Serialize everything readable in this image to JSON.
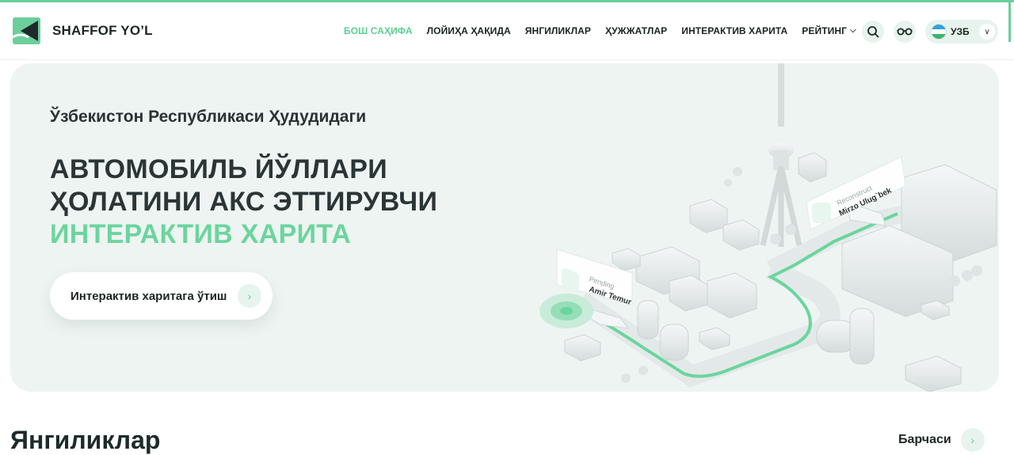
{
  "brand": {
    "name": "SHAFFOF YO’L",
    "accent": "#6ccf9b"
  },
  "nav": {
    "items": [
      {
        "label": "БОШ САҲИФА",
        "active": true
      },
      {
        "label": "ЛОЙИҲА ҲАҚИДА"
      },
      {
        "label": "ЯНГИЛИКЛАР"
      },
      {
        "label": "ҲУЖЖАТЛАР"
      },
      {
        "label": "ИНТЕРАКТИВ ХАРИТА"
      },
      {
        "label": "РЕЙТИНГ",
        "dropdown": true
      }
    ]
  },
  "toolbar": {
    "search_icon": "search-icon",
    "accessibility_icon": "glasses-icon"
  },
  "language": {
    "current": "УЗБ",
    "flag": "uzbekistan-flag-icon"
  },
  "hero": {
    "subtitle": "Ўзбекистон Республикаси Ҳудудидаги",
    "title_line1": "АВТОМОБИЛЬ ЙЎЛЛАРИ",
    "title_line2": "ҲОЛАТИНИ АКС ЭТТИРУВЧИ",
    "title_line3": "ИНТЕРАКТИВ ХАРИТА",
    "cta_label": "Интерактив харитага ўтиш",
    "map_labels": {
      "label_a_status": "Pending",
      "label_a_street": "Amir Temur",
      "label_b_status": "Reconstruct",
      "label_b_street": "Mirzo Ulug`bek"
    }
  },
  "news": {
    "title": "Янгиликлар",
    "all_label": "Барчаси"
  }
}
